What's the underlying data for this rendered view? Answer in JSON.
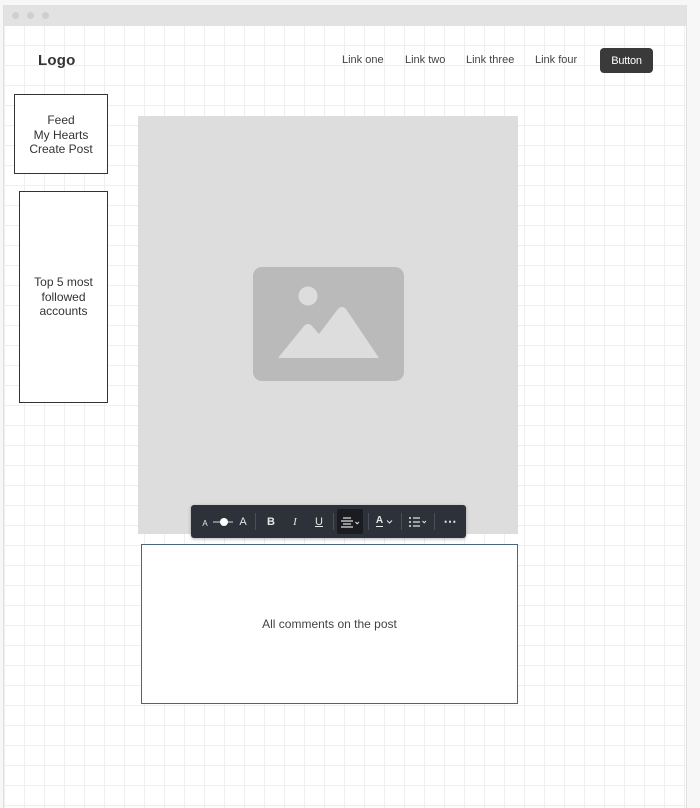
{
  "header": {
    "logo": "Logo",
    "nav_links": [
      "Link one",
      "Link two",
      "Link three",
      "Link four"
    ],
    "button_label": "Button"
  },
  "sidebar": {
    "menu_items": [
      "Feed",
      "My Hearts",
      "Create Post"
    ],
    "top_accounts_label": "Top 5 most followed accounts"
  },
  "main": {
    "image_icon": "image-placeholder-icon",
    "comments_label": "All comments on the post"
  },
  "toolbar": {
    "font_size_small": "A",
    "font_size_large": "A",
    "bold": "B",
    "italic": "I",
    "underline": "U",
    "text_color": "A",
    "more": "⋯"
  },
  "colors": {
    "toolbar_bg": "#2d3139",
    "button_bg": "#3a3a3a",
    "image_bg": "#dddddd",
    "image_icon": "#bababa"
  }
}
